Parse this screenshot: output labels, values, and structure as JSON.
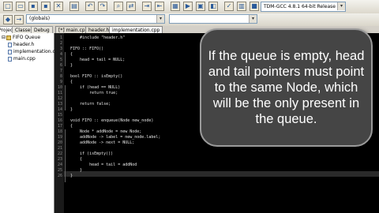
{
  "toolbar": {
    "compiler_select": "TDM-GCC 4.8.1 64-bit Release"
  },
  "toolbar2": {
    "scope_select": "(globals)"
  },
  "panel_tabs": [
    "Projects",
    "Classes",
    "Debug"
  ],
  "file_tabs": [
    {
      "label": "[*] main.cpp"
    },
    {
      "label": "header.h"
    },
    {
      "label": "implementation.cpp"
    }
  ],
  "project_tree": {
    "project": "FIFO Queue",
    "files": [
      "header.h",
      "implementation.cpp",
      "main.cpp"
    ]
  },
  "editor": {
    "lines": [
      {
        "n": "1",
        "text": "    #include \"header.h\""
      },
      {
        "n": "2",
        "text": ""
      },
      {
        "n": "3",
        "text": "FIFO :: FIFO()"
      },
      {
        "n": "4",
        "text": "{"
      },
      {
        "n": "5",
        "text": "    head = tail = NULL;"
      },
      {
        "n": "6",
        "text": "}"
      },
      {
        "n": "7",
        "text": ""
      },
      {
        "n": "8",
        "text": "bool FIFO :: isEmpty()"
      },
      {
        "n": "9",
        "text": "{"
      },
      {
        "n": "10",
        "text": "    if (head == NULL)"
      },
      {
        "n": "11",
        "text": "        return true;"
      },
      {
        "n": "12",
        "text": ""
      },
      {
        "n": "13",
        "text": "    return false;"
      },
      {
        "n": "14",
        "text": "}"
      },
      {
        "n": "15",
        "text": ""
      },
      {
        "n": "16",
        "text": "void FIFO :: enqueue(Node new_node)"
      },
      {
        "n": "17",
        "text": "{"
      },
      {
        "n": "18",
        "text": "    Node * addNode = new Node;"
      },
      {
        "n": "19",
        "text": "    addNode -> label = new_node.label;"
      },
      {
        "n": "20",
        "text": "    addNode -> next = NULL;"
      },
      {
        "n": "21",
        "text": ""
      },
      {
        "n": "22",
        "text": "    if (isEmpty())"
      },
      {
        "n": "23",
        "text": "    {"
      },
      {
        "n": "24",
        "text": "        head = tail = addNod"
      },
      {
        "n": "25",
        "text": "    }"
      },
      {
        "n": "26",
        "text": "}"
      }
    ]
  },
  "callout": {
    "text": "If the queue is empty, head and tail pointers must point to the same Node, which will be the only present in the queue."
  },
  "colors": {
    "editor_bg": "#000000",
    "callout_bg": "#454545",
    "callout_border": "#9a9a9a"
  }
}
